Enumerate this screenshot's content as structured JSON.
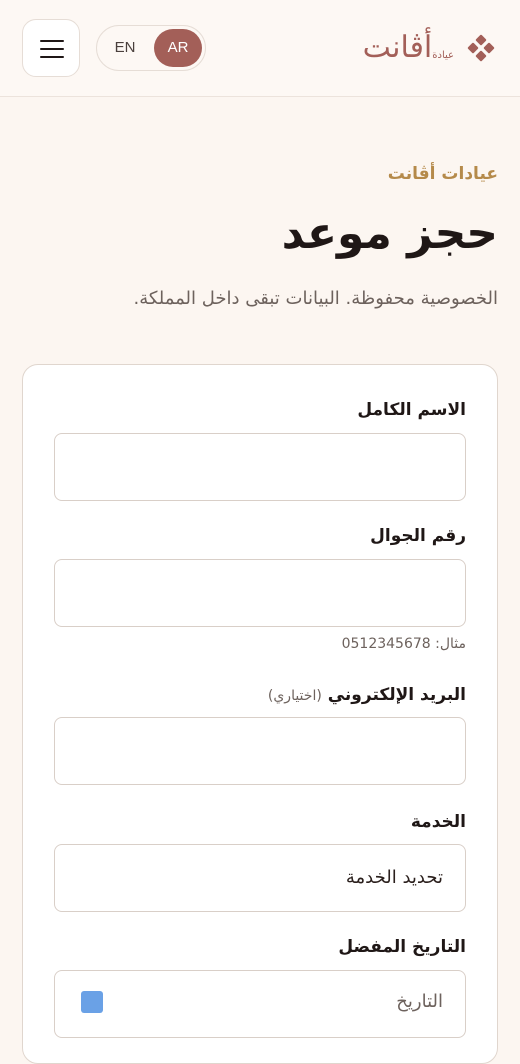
{
  "header": {
    "logo_word": "أڤانت",
    "logo_sub": "عيادة",
    "lang_en": "EN",
    "lang_ar": "AR"
  },
  "page": {
    "eyebrow": "عيادات أڤانت",
    "title": "حجز موعد",
    "subtitle": "الخصوصية محفوظة. البيانات تبقى داخل المملكة."
  },
  "form": {
    "name_label": "الاسم الكامل",
    "phone_label": "رقم الجوال",
    "phone_hint": "مثال: 0512345678",
    "email_label": "البريد الإلكتروني",
    "email_optional": "(اختياري)",
    "service_label": "الخدمة",
    "service_value": "تحديد الخدمة",
    "date_label": "التاريخ المفضل",
    "date_value": "التاريخ"
  }
}
